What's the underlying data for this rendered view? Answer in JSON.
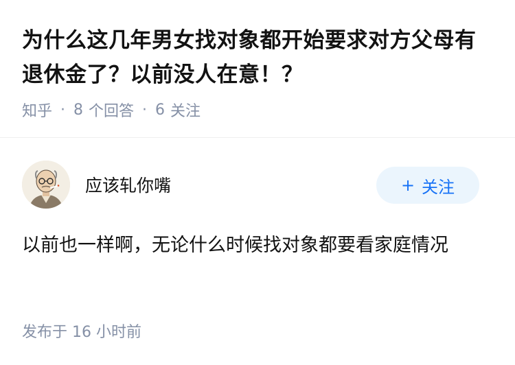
{
  "question": {
    "title": "为什么这几年男女找对象都开始要求对方父母有退休金了？以前没人在意！？",
    "source": "知乎",
    "answer_count": "8",
    "answer_count_label": "个回答",
    "follower_count": "6",
    "follower_count_label": "关注",
    "separator": "·"
  },
  "answer": {
    "author_name": "应该轧你嘴",
    "follow_icon": "+",
    "follow_label": "关注",
    "content": "以前也一样啊，无论什么时候找对象都要看家庭情况",
    "published_prefix": "发布于",
    "published_time": "16 小时前"
  },
  "colors": {
    "accent": "#1772f6",
    "follow_bg": "#ebf5fd",
    "meta_gray": "#8590a6",
    "text": "#121212"
  }
}
